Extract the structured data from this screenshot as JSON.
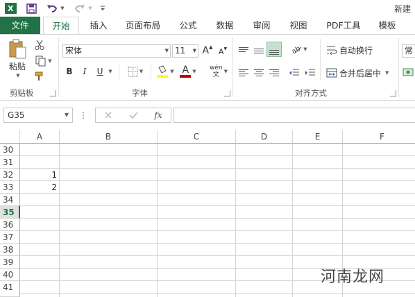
{
  "title": "新建",
  "tabs": [
    {
      "label": "文件"
    },
    {
      "label": "开始"
    },
    {
      "label": "插入"
    },
    {
      "label": "页面布局"
    },
    {
      "label": "公式"
    },
    {
      "label": "数据"
    },
    {
      "label": "审阅"
    },
    {
      "label": "视图"
    },
    {
      "label": "PDF工具"
    },
    {
      "label": "模板"
    }
  ],
  "ribbon": {
    "clipboard": {
      "paste_label": "粘贴",
      "group_label": "剪贴板"
    },
    "font": {
      "font_name": "宋体",
      "font_size": "11",
      "bold": "B",
      "italic": "I",
      "underline": "U",
      "grow": "A",
      "shrink": "A",
      "font_color_glyph": "A",
      "phonetic": "wén",
      "group_label": "字体",
      "fill_color": "#ffff00",
      "text_color": "#c00000"
    },
    "alignment": {
      "wrap_text": "自动换行",
      "merge_center": "合并后居中",
      "group_label": "对齐方式"
    },
    "number_format_partial": "常规"
  },
  "formula_bar": {
    "name_box": "G35",
    "fx": "fx",
    "formula": ""
  },
  "sheet": {
    "columns": [
      "A",
      "B",
      "C",
      "D",
      "E",
      "F"
    ],
    "rows": [
      "30",
      "31",
      "32",
      "33",
      "34",
      "35",
      "36",
      "37",
      "38",
      "39",
      "40",
      "41"
    ],
    "selected_row": "35",
    "cells": {
      "A32": "1",
      "A33": "2"
    }
  },
  "watermark": "河南龙网"
}
